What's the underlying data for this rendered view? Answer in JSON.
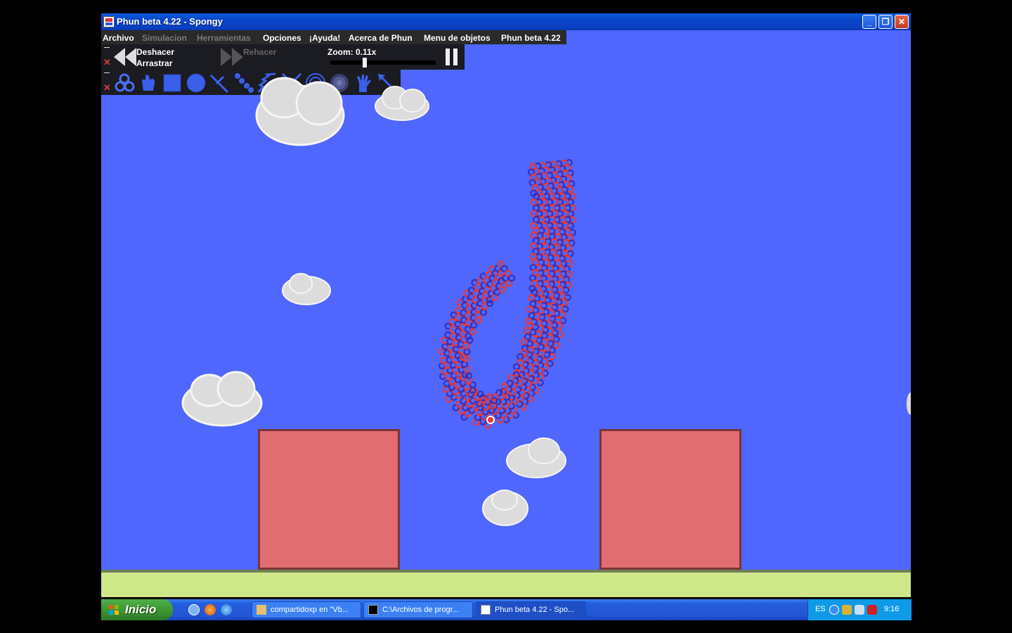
{
  "window": {
    "title": "Phun beta 4.22 - Spongy",
    "minimize": "_",
    "restore": "❐",
    "close": "✕"
  },
  "menu": [
    {
      "label": "Archivo",
      "enabled": true
    },
    {
      "label": "Simulacion",
      "enabled": false
    },
    {
      "label": "Herramientas",
      "enabled": false
    },
    {
      "label": "Opciones",
      "enabled": true
    },
    {
      "label": "¡Ayuda!",
      "enabled": true
    },
    {
      "label": "Acerca de Phun",
      "enabled": true
    },
    {
      "label": "Menu de objetos",
      "enabled": true
    },
    {
      "label": "Phun beta 4.22",
      "enabled": true
    }
  ],
  "toolbar": {
    "undo_label": "Deshacer",
    "drag_label": "Arrastrar",
    "redo_label": "Rehacer",
    "zoom_label": "Zoom: 0.11x",
    "zoom_level": 0.32,
    "close_glyph": "✕"
  },
  "tools": [
    "spongy-chain-tool-icon",
    "hand-drag-tool-icon",
    "box-tool-icon",
    "circle-tool-icon",
    "fixate-tool-icon",
    "chain-tool-icon",
    "spring-tool-icon",
    "cut-tool-icon",
    "hinge-tool-icon",
    "texture-tool-icon",
    "grab-hand-tool-icon",
    "resize-tool-icon"
  ],
  "colors": {
    "sky": "#4f66ff",
    "ground": "#cfe88a",
    "box": "#e06e70",
    "particle_red": "#e23a3a",
    "particle_blue": "#3830b8"
  },
  "taskbar": {
    "start_label": "Inicio",
    "tasks": [
      {
        "label": "compartidoxp en \"Vb...",
        "active": false
      },
      {
        "label": "C:\\Archivos de progr...",
        "active": false
      },
      {
        "label": "Phun beta 4.22 - Spo...",
        "active": true
      }
    ],
    "language": "ES",
    "clock": "9:16"
  }
}
